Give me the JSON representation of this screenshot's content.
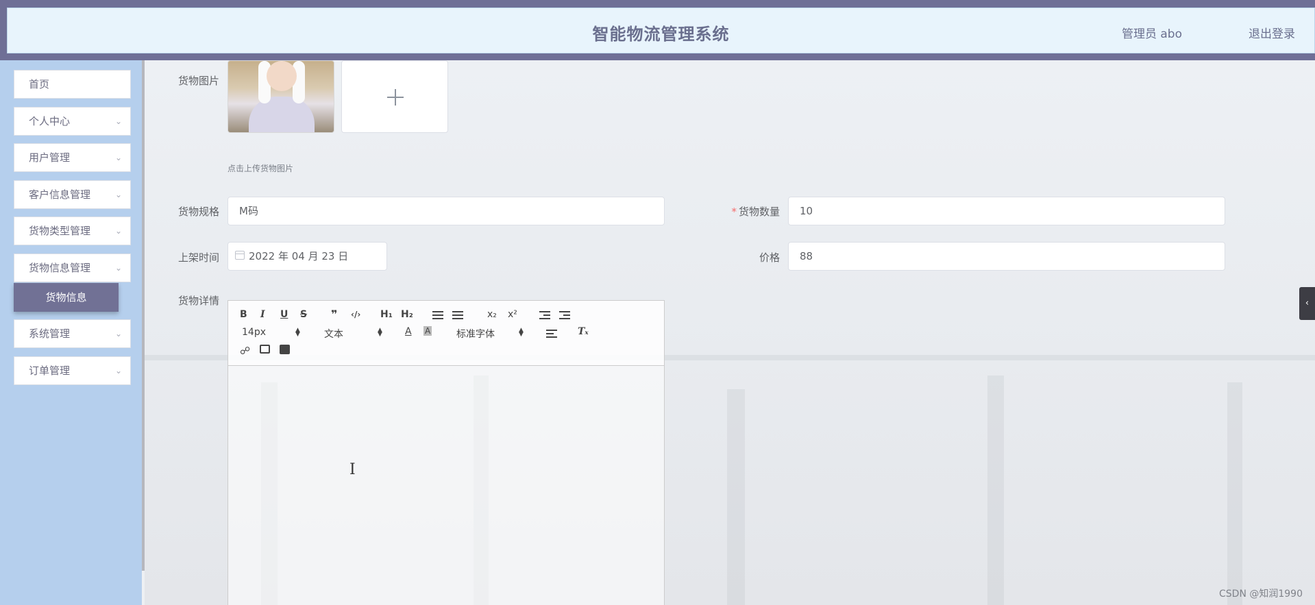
{
  "header": {
    "title": "智能物流管理系统",
    "user": "管理员 abo",
    "logout": "退出登录"
  },
  "sidebar": {
    "items": [
      {
        "label": "首页"
      },
      {
        "label": "个人中心"
      },
      {
        "label": "用户管理"
      },
      {
        "label": "客户信息管理"
      },
      {
        "label": "货物类型管理"
      },
      {
        "label": "货物信息管理"
      },
      {
        "label": "系统管理"
      },
      {
        "label": "订单管理"
      }
    ],
    "active_sub": "货物信息"
  },
  "form": {
    "image_label": "货物图片",
    "upload_tip": "点击上传货物图片",
    "spec_label": "货物规格",
    "spec_value": "M码",
    "qty_label": "货物数量",
    "qty_required": "*",
    "qty_value": "10",
    "date_label": "上架时间",
    "date_value": "2022 年 04 月 23 日",
    "price_label": "价格",
    "price_value": "88",
    "detail_label": "货物详情"
  },
  "editor": {
    "buttons_row1": [
      "B",
      "I",
      "U",
      "S",
      "❞",
      "‹/›",
      "H₁",
      "H₂",
      "x₂",
      "x²"
    ],
    "size_value": "14px",
    "header_value": "文本",
    "font_value": "标准字体",
    "clean_glyph": "Tₓ"
  },
  "watermark": "CSDN @知润1990",
  "colors": {
    "header_bg": "#6f6f96",
    "header_inner": "#e8f4fc",
    "sidebar_bg": "#b5cfed",
    "active_item": "#717195",
    "required": "#f56c6c"
  }
}
